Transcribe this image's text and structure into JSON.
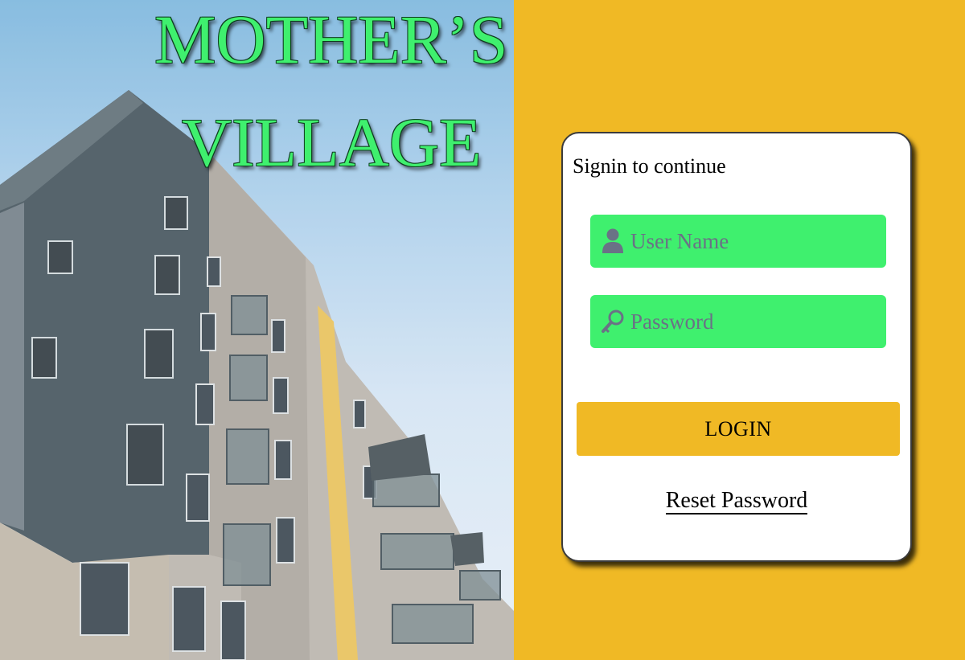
{
  "hero": {
    "title_line1": "MOTHER’S",
    "title_line2": "VILLAGE",
    "title_color": "#3ff06e",
    "background_image": "apartment-building-photo"
  },
  "login": {
    "heading": "Signin to continue",
    "username_placeholder": "User Name",
    "username_icon": "user-icon",
    "password_placeholder": "Password",
    "password_icon": "key-icon",
    "login_button": "LOGIN",
    "reset_link": "Reset Password"
  },
  "colors": {
    "panel_background": "#f0b925",
    "input_background": "#3ff06e",
    "card_background": "#ffffff",
    "button_background": "#f0b925"
  }
}
